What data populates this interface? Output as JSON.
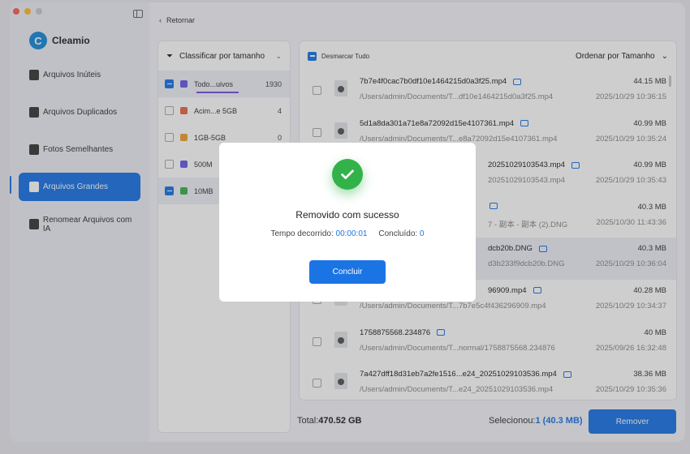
{
  "app": {
    "name": "Cleamio",
    "logo_letter": "C"
  },
  "sidebar": {
    "items": [
      {
        "label": "Arquivos Inúteis",
        "icon": "trash-icon",
        "active": false
      },
      {
        "label": "Arquivos Duplicados",
        "icon": "duplicate-files-icon",
        "active": false
      },
      {
        "label": "Fotos Semelhantes",
        "icon": "photos-icon",
        "active": false
      },
      {
        "label": "Arquivos Grandes",
        "icon": "large-file-icon",
        "active": true
      },
      {
        "label": "Renomear Arquivos com IA",
        "icon": "rename-ai-icon",
        "active": false
      }
    ]
  },
  "header": {
    "back_label": "Retornar"
  },
  "filter": {
    "sort_label": "Classificar por tamanho",
    "rows": [
      {
        "label": "Todo...uivos",
        "count": "1930",
        "checked": "on",
        "color": "#6b5ce7"
      },
      {
        "label": "Acim...e 5GB",
        "count": "4",
        "checked": "off",
        "color": "#e8694a"
      },
      {
        "label": "1GB-5GB",
        "count": "0",
        "checked": "off",
        "color": "#f0a030"
      },
      {
        "label": "500M",
        "count": "",
        "checked": "off",
        "color": "#6b5ce7"
      },
      {
        "label": "10MB",
        "count": "",
        "checked": "on",
        "color": "#3bb34a"
      }
    ]
  },
  "files": {
    "deselect_label": "Desmarcar Tudo",
    "order_label": "Ordenar por Tamanho",
    "size_unit": "MB",
    "rows": [
      {
        "name": "7b7e4f0cac7b0df10e1464215d0a3f25.mp4",
        "path": "/Users/admin/Documents/T...df10e1464215d0a3f25.mp4",
        "size": "44.15",
        "date": "2025/10/29 10:36:15"
      },
      {
        "name": "5d1a8da301a71e8a72092d15e4107361.mp4",
        "path": "/Users/admin/Documents/T...e8a72092d15e4107361.mp4",
        "size": "40.99",
        "date": "2025/10/29 10:35:24"
      },
      {
        "name": "20251029103543.mp4",
        "path": "20251029103543.mp4",
        "size": "40.99",
        "date": "2025/10/29 10:35:43"
      },
      {
        "name": "",
        "path": "7 - 副本 - 副本 (2).DNG",
        "size": "40.3",
        "date": "2025/10/30 11:43:36"
      },
      {
        "name": "dcb20b.DNG",
        "path": "d3b233f9dcb20b.DNG",
        "size": "40.3",
        "date": "2025/10/29 10:36:04"
      },
      {
        "name": "96909.mp4",
        "path": "/Users/admin/Documents/T...7b7e5c4f436296909.mp4",
        "size": "40.28",
        "date": "2025/10/29 10:34:37"
      },
      {
        "name": "1758875568.234876",
        "path": "/Users/admin/Documents/T...normal/1758875568.234876",
        "size": "40",
        "date": "2025/09/26 16:32:48"
      },
      {
        "name": "7a427dff18d31eb7a2fe1516...e24_20251029103536.mp4",
        "path": "/Users/admin/Documents/T...e24_20251029103536.mp4",
        "size": "38.36",
        "date": "2025/10/29 10:35:36"
      }
    ]
  },
  "footer": {
    "total_label": "Total:",
    "total_value": "470.52 GB",
    "selected_label": "Selecionou:",
    "selected_value": "1 (40.3   MB)",
    "remove_label": "Remover"
  },
  "dialog": {
    "title": "Removido com sucesso",
    "elapsed_label": "Tempo decorrido:",
    "elapsed_value": "00:00:01",
    "done_label": "Concluído:",
    "done_value": "0",
    "button_label": "Concluir"
  },
  "colors": {
    "accent": "#1b74e4",
    "success": "#33b24a"
  }
}
